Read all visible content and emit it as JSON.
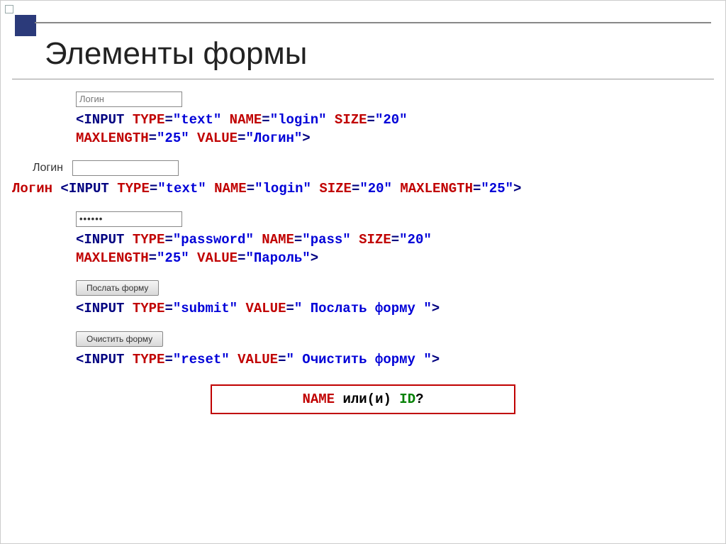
{
  "title": "Элементы формы",
  "example1": {
    "input_value": "Логин",
    "code": [
      {
        "cls": "k-navy",
        "t": "<INPUT "
      },
      {
        "cls": "k-red",
        "t": "TYPE"
      },
      {
        "cls": "k-navy",
        "t": "="
      },
      {
        "cls": "k-blue",
        "t": "\"text\""
      },
      {
        "cls": "k-navy",
        "t": " "
      },
      {
        "cls": "k-red",
        "t": "NAME"
      },
      {
        "cls": "k-navy",
        "t": "="
      },
      {
        "cls": "k-blue",
        "t": "\"login\""
      },
      {
        "cls": "k-navy",
        "t": " "
      },
      {
        "cls": "k-red",
        "t": "SIZE"
      },
      {
        "cls": "k-navy",
        "t": "="
      },
      {
        "cls": "k-blue",
        "t": "\"20\""
      },
      {
        "cls": "",
        "t": "\n"
      },
      {
        "cls": "k-red",
        "t": "MAXLENGTH"
      },
      {
        "cls": "k-navy",
        "t": "="
      },
      {
        "cls": "k-blue",
        "t": "\"25\""
      },
      {
        "cls": "k-navy",
        "t": " "
      },
      {
        "cls": "k-red",
        "t": "VALUE"
      },
      {
        "cls": "k-navy",
        "t": "="
      },
      {
        "cls": "k-blue",
        "t": "\"Логин\""
      },
      {
        "cls": "k-navy",
        "t": ">"
      }
    ]
  },
  "example2": {
    "label": "Логин",
    "code_prefix": "Логин",
    "code": [
      {
        "cls": "k-navy",
        "t": " <INPUT "
      },
      {
        "cls": "k-red",
        "t": "TYPE"
      },
      {
        "cls": "k-navy",
        "t": "="
      },
      {
        "cls": "k-blue",
        "t": "\"text\""
      },
      {
        "cls": "k-navy",
        "t": " "
      },
      {
        "cls": "k-red",
        "t": "NAME"
      },
      {
        "cls": "k-navy",
        "t": "="
      },
      {
        "cls": "k-blue",
        "t": "\"login\""
      },
      {
        "cls": "k-navy",
        "t": " "
      },
      {
        "cls": "k-red",
        "t": "SIZE"
      },
      {
        "cls": "k-navy",
        "t": "="
      },
      {
        "cls": "k-blue",
        "t": "\"20\""
      },
      {
        "cls": "k-navy",
        "t": " "
      },
      {
        "cls": "k-red",
        "t": "MAXLENGTH"
      },
      {
        "cls": "k-navy",
        "t": "="
      },
      {
        "cls": "k-blue",
        "t": "\"25\""
      },
      {
        "cls": "k-navy",
        "t": ">"
      }
    ]
  },
  "example3": {
    "input_value": "••••••",
    "code": [
      {
        "cls": "k-navy",
        "t": "<INPUT "
      },
      {
        "cls": "k-red",
        "t": "TYPE"
      },
      {
        "cls": "k-navy",
        "t": "="
      },
      {
        "cls": "k-blue",
        "t": "\"password\""
      },
      {
        "cls": "k-navy",
        "t": " "
      },
      {
        "cls": "k-red",
        "t": "NAME"
      },
      {
        "cls": "k-navy",
        "t": "="
      },
      {
        "cls": "k-blue",
        "t": "\"pass\""
      },
      {
        "cls": "k-navy",
        "t": " "
      },
      {
        "cls": "k-red",
        "t": "SIZE"
      },
      {
        "cls": "k-navy",
        "t": "="
      },
      {
        "cls": "k-blue",
        "t": "\"20\""
      },
      {
        "cls": "",
        "t": "\n"
      },
      {
        "cls": "k-red",
        "t": "MAXLENGTH"
      },
      {
        "cls": "k-navy",
        "t": "="
      },
      {
        "cls": "k-blue",
        "t": "\"25\""
      },
      {
        "cls": "k-navy",
        "t": " "
      },
      {
        "cls": "k-red",
        "t": "VALUE"
      },
      {
        "cls": "k-navy",
        "t": "="
      },
      {
        "cls": "k-blue",
        "t": "\"Пароль\""
      },
      {
        "cls": "k-navy",
        "t": ">"
      }
    ]
  },
  "example4": {
    "button_label": "Послать форму",
    "code": [
      {
        "cls": "k-navy",
        "t": "<INPUT "
      },
      {
        "cls": "k-red",
        "t": "TYPE"
      },
      {
        "cls": "k-navy",
        "t": "="
      },
      {
        "cls": "k-blue",
        "t": "\"submit\""
      },
      {
        "cls": "k-navy",
        "t": " "
      },
      {
        "cls": "k-red",
        "t": "VALUE"
      },
      {
        "cls": "k-navy",
        "t": "="
      },
      {
        "cls": "k-blue",
        "t": "\" Послать форму \""
      },
      {
        "cls": "k-navy",
        "t": ">"
      }
    ]
  },
  "example5": {
    "button_label": "Очистить форму",
    "code": [
      {
        "cls": "k-navy",
        "t": "<INPUT "
      },
      {
        "cls": "k-red",
        "t": "TYPE"
      },
      {
        "cls": "k-navy",
        "t": "="
      },
      {
        "cls": "k-blue",
        "t": "\"reset\""
      },
      {
        "cls": "k-navy",
        "t": " "
      },
      {
        "cls": "k-red",
        "t": "VALUE"
      },
      {
        "cls": "k-navy",
        "t": "="
      },
      {
        "cls": "k-blue",
        "t": "\" Очистить форму \""
      },
      {
        "cls": "k-navy",
        "t": ">"
      }
    ]
  },
  "callout_parts": [
    {
      "cls": "k-red",
      "t": "NAME"
    },
    {
      "cls": "k-black",
      "t": " или(и) "
    },
    {
      "cls": "k-green",
      "t": "ID"
    },
    {
      "cls": "k-black",
      "t": "?"
    }
  ]
}
